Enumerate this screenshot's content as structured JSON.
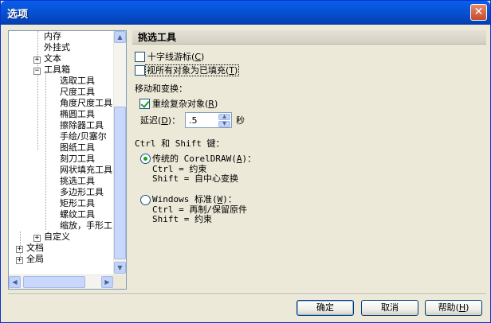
{
  "window": {
    "title": "选项",
    "close_glyph": "✕"
  },
  "tree": {
    "items": [
      "内存",
      "外挂式",
      "文本",
      "工具箱",
      "选取工具",
      "尺度工具",
      "角度尺度工具",
      "椭圆工具",
      "擦除器工具",
      "手绘/贝塞尔",
      "图纸工具",
      "刻刀工具",
      "网状填充工具",
      "挑选工具",
      "多边形工具",
      "矩形工具",
      "螺纹工具",
      "缩放，手形工",
      "自定义",
      "文档",
      "全局"
    ],
    "expander_plus": "+",
    "expander_minus": "−"
  },
  "panel": {
    "title": "挑选工具",
    "crosshair_label": "十字线游标",
    "crosshair_key": "C",
    "treat_filled_label": "视所有对象为已填充",
    "treat_filled_key": "T",
    "move_section": "移动和变换：",
    "redraw_label": "重绘复杂对象",
    "redraw_key": "R",
    "delay_label": "延迟",
    "delay_key": "D",
    "delay_value": ".5",
    "delay_unit": "秒",
    "keys_section": "Ctrl 和 Shift 键：",
    "traditional_label": "传统的 CorelDRAW",
    "traditional_key": "A",
    "traditional_ctrl": "Ctrl = 约束",
    "traditional_shift": "Shift = 自中心变换",
    "windows_label": "Windows 标准",
    "windows_key": "W",
    "windows_ctrl": "Ctrl = 再制/保留原件",
    "windows_shift": "Shift = 约束"
  },
  "footer": {
    "ok": "确定",
    "cancel": "取消",
    "help": "帮助",
    "help_key": "H"
  }
}
